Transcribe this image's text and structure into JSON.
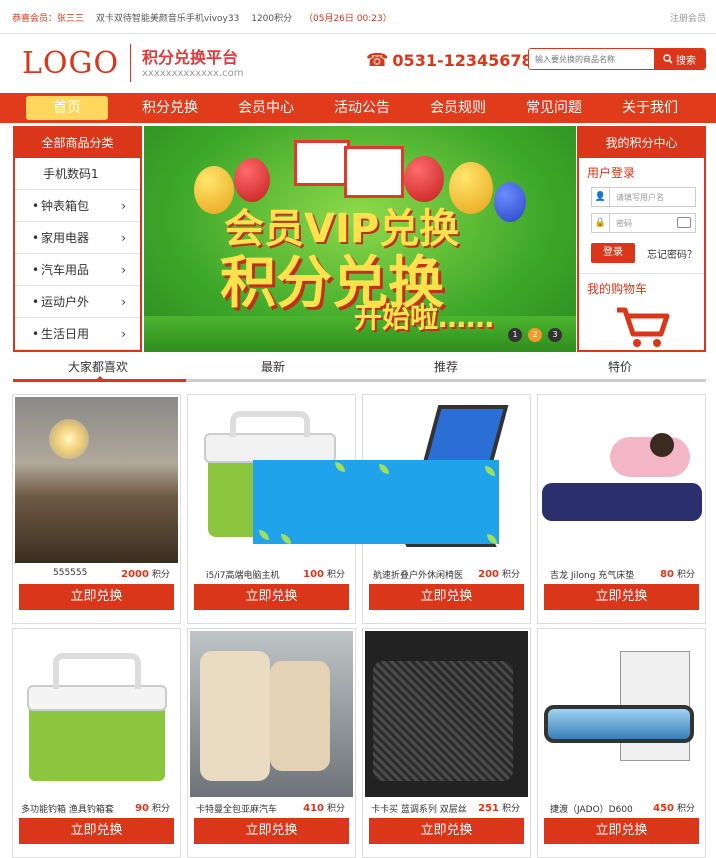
{
  "topbar": {
    "greeting": "恭喜会员：张三三",
    "product": "双卡双待智能美颜音乐手机vivoy33",
    "points": "1200积分",
    "date": "（05月26日 00:23）",
    "register": "注册会员"
  },
  "header": {
    "logo": "LOGO",
    "site_title": "积分兑换平台",
    "domain": "xxxxxxxxxxxxx.com",
    "phone": "0531-12345678",
    "search_placeholder": "输入要兑换的商品名称",
    "search_label": "搜索"
  },
  "nav": {
    "items": [
      "首页",
      "积分兑换",
      "会员中心",
      "活动公告",
      "会员规则",
      "常见问题",
      "关于我们"
    ]
  },
  "categories": {
    "title": "全部商品分类",
    "items": [
      "手机数码1",
      "钟表箱包",
      "家用电器",
      "汽车用品",
      "运动户外",
      "生活日用"
    ]
  },
  "banner": {
    "line1": "会员VIP兑换",
    "line2": "积分兑换",
    "line3": "开始啦……",
    "dots": [
      "1",
      "2",
      "3"
    ]
  },
  "member": {
    "title": "我的积分中心",
    "login_title": "用户登录",
    "user_placeholder": "请填写用户名",
    "pass_placeholder": "密码",
    "login_button": "登录",
    "forgot": "忘记密码？",
    "cart_title": "我的购物车"
  },
  "tabs": [
    "大家都喜欢",
    "最新",
    "推荐",
    "特价"
  ],
  "products": [
    {
      "name": "555555",
      "points": "2000",
      "unit": "积分",
      "button": "立即兑换"
    },
    {
      "name": "i5/i7高端电脑主机",
      "points": "100",
      "unit": "积分",
      "button": "立即兑换"
    },
    {
      "name": "航速折叠户外休闲椅医",
      "points": "200",
      "unit": "积分",
      "button": "立即兑换"
    },
    {
      "name": "吉龙 Jilong 充气床垫",
      "points": "80",
      "unit": "积分",
      "button": "立即兑换"
    },
    {
      "name": "多功能钓箱 渔具钓箱套",
      "points": "90",
      "unit": "积分",
      "button": "立即兑换"
    },
    {
      "name": "卡特曼全包亚麻汽车",
      "points": "410",
      "unit": "积分",
      "button": "立即兑换"
    },
    {
      "name": "卡卡买 蓝调系列 双层丝",
      "points": "251",
      "unit": "积分",
      "button": "立即兑换"
    },
    {
      "name": "捷渡（JADO）D600",
      "points": "450",
      "unit": "积分",
      "button": "立即兑换"
    }
  ],
  "colors": {
    "brand": "#d9361a",
    "nav_active": "#ffd75c",
    "overlay": "#21a3ec"
  }
}
